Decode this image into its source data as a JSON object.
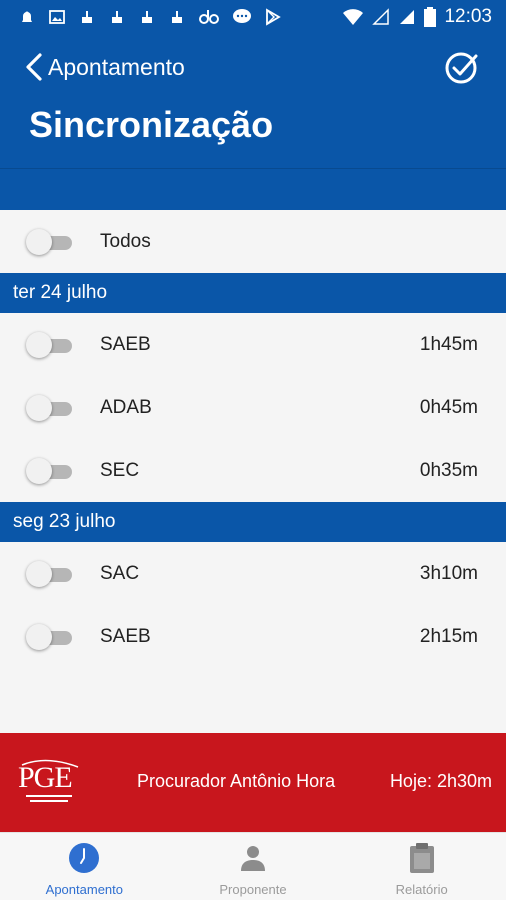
{
  "status_bar": {
    "time": "12:03",
    "icons_left": [
      "notification-icon",
      "image-icon",
      "notification-icon",
      "notification-icon",
      "notification-icon",
      "notification-icon",
      "app-icon",
      "chat-icon",
      "play-store-icon"
    ],
    "icons_right": [
      "wifi-icon",
      "signal-empty-icon",
      "signal-icon",
      "battery-icon"
    ]
  },
  "header": {
    "back_label": "Apontamento",
    "title": "Sincronização",
    "confirm_icon": "check-circle-icon"
  },
  "all_toggle": {
    "label": "Todos",
    "on": false
  },
  "sections": [
    {
      "date": "ter 24 julho",
      "items": [
        {
          "label": "SAEB",
          "time": "1h45m",
          "on": false
        },
        {
          "label": "ADAB",
          "time": "0h45m",
          "on": false
        },
        {
          "label": "SEC",
          "time": "0h35m",
          "on": false
        }
      ]
    },
    {
      "date": "seg 23 julho",
      "items": [
        {
          "label": "SAC",
          "time": "3h10m",
          "on": false
        },
        {
          "label": "SAEB",
          "time": "2h15m",
          "on": false
        }
      ]
    }
  ],
  "footer": {
    "logo_text": "PGE",
    "user": "Procurador Antônio Hora",
    "today": "Hoje: 2h30m"
  },
  "bottom_nav": [
    {
      "label": "Apontamento",
      "icon": "clock-icon",
      "active": true
    },
    {
      "label": "Proponente",
      "icon": "person-icon",
      "active": false
    },
    {
      "label": "Relatório",
      "icon": "clipboard-icon",
      "active": false
    }
  ],
  "colors": {
    "primary": "#0a56a8",
    "banner": "#c8161d",
    "active_nav": "#2f6fd0"
  }
}
